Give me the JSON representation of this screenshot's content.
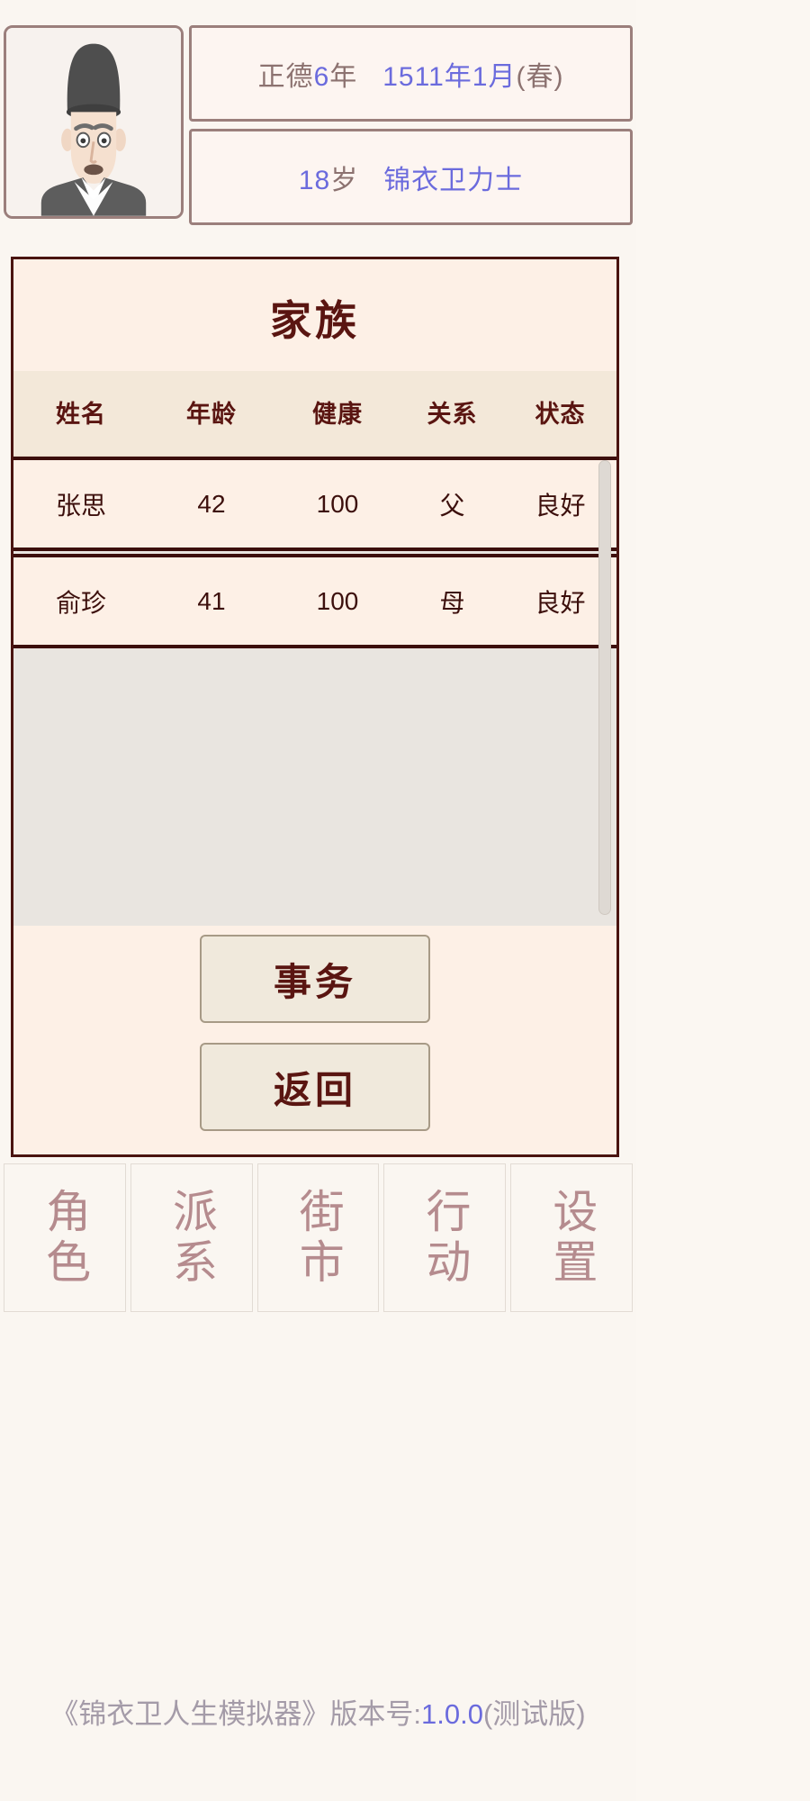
{
  "status_bar": {
    "avatar_alt": "official-portrait",
    "row1": {
      "era_prefix": "正德",
      "era_year": "6",
      "era_suffix": "年",
      "gregorian": "1511年1月",
      "season": "(春)"
    },
    "row2": {
      "age": "18",
      "age_unit": "岁",
      "rank": "锦衣卫力士"
    }
  },
  "panel": {
    "title": "家族",
    "columns": [
      "姓名",
      "年龄",
      "健康",
      "关系",
      "状态"
    ],
    "rows": [
      {
        "name": "张思",
        "age": "42",
        "health": "100",
        "relation": "父",
        "state": "良好"
      },
      {
        "name": "俞珍",
        "age": "41",
        "health": "100",
        "relation": "母",
        "state": "良好"
      }
    ],
    "buttons": {
      "affairs": "事务",
      "back": "返回"
    }
  },
  "nav": {
    "items": [
      {
        "label": "角色"
      },
      {
        "label": "派系"
      },
      {
        "label": "街市"
      },
      {
        "label": "行动"
      },
      {
        "label": "设置"
      }
    ]
  },
  "footer": {
    "game_title": "《锦衣卫人生模拟器》",
    "version_label": "版本号:",
    "version_number": "1.0.0",
    "build_tag": "(测试版)"
  },
  "colors": {
    "panel_border": "#4a1410",
    "title_text": "#5a1511",
    "accent_blue": "#6b6bdd",
    "muted_brown": "#8c7270",
    "nav_text": "#b58b8e",
    "panel_bg": "#fdf0e6",
    "page_bg": "#faf6f1"
  }
}
